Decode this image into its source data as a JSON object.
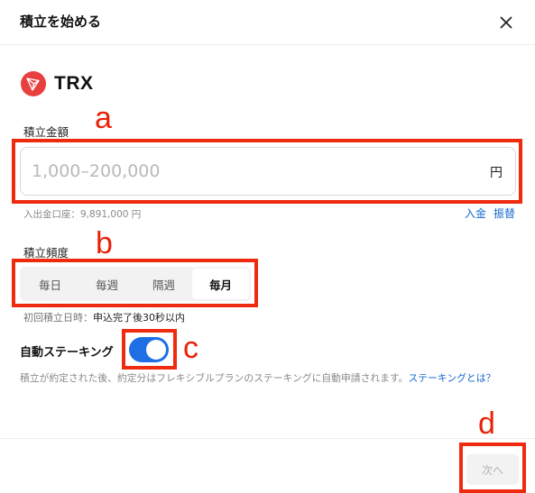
{
  "header": {
    "title": "積立を始める",
    "close_icon": "close-icon"
  },
  "asset": {
    "name": "TRX",
    "logo_icon": "tron-icon",
    "logo_color": "#e8403f"
  },
  "amount": {
    "label": "積立金額",
    "placeholder": "1,000–200,000",
    "value": "",
    "unit": "円",
    "balance_text": "入出金口座：9,891,000 円",
    "links": [
      "入金",
      "振替"
    ]
  },
  "frequency": {
    "label": "積立頻度",
    "options": [
      "毎日",
      "毎週",
      "隔週",
      "毎月"
    ],
    "selected": "毎月"
  },
  "first_date": {
    "label": "初回積立日時：",
    "value": "申込完了後30秒以内"
  },
  "staking": {
    "label": "自動ステーキング",
    "enabled": true,
    "description": "積立が約定された後、約定分はフレキシブルプランのステーキングに自動申請されます。",
    "link_text": "ステーキングとは？"
  },
  "footer": {
    "next_label": "次へ"
  },
  "annotations": [
    "a",
    "b",
    "c",
    "d"
  ],
  "colors": {
    "accent": "#1d6fe3",
    "link": "#1769d1",
    "annotation": "#ee2a0f"
  }
}
